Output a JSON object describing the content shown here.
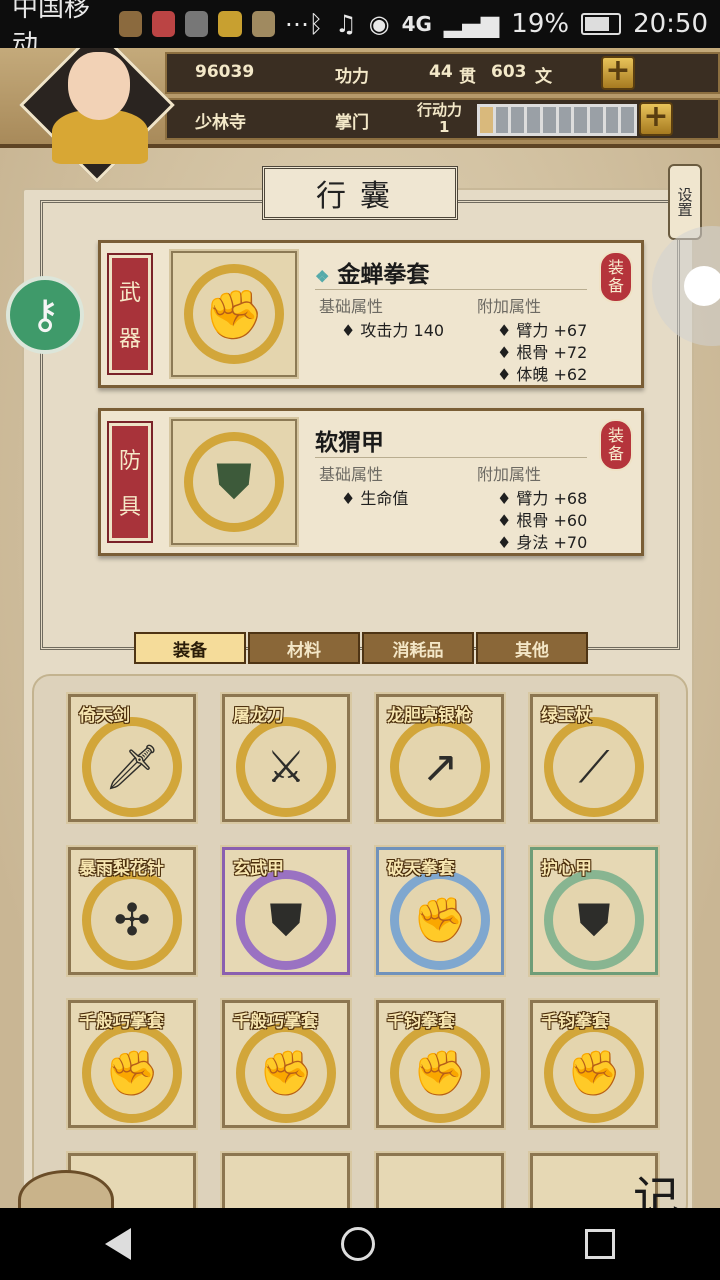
{
  "status_bar": {
    "carrier": "中国移动",
    "network": "4G",
    "battery_percent": "19%",
    "time": "20:50"
  },
  "header": {
    "power_value": "96039",
    "power_label": "功力",
    "money_guan": "44",
    "money_guan_unit": "贯",
    "money_wen": "603",
    "money_wen_unit": "文",
    "sect": "少林寺",
    "rank": "掌门",
    "stamina_label": "行动力",
    "stamina_value": "1",
    "stamina_segments_filled": 1,
    "stamina_segments_total": 10
  },
  "title": "行囊",
  "settings_label": "设置",
  "equipped": [
    {
      "slot_chars": [
        "武",
        "器"
      ],
      "name": "金蝉拳套",
      "base_header": "基础属性",
      "extra_header": "附加属性",
      "base_stats": [
        "♦ 攻击力 140"
      ],
      "extra_stats": [
        "♦ 臂力 +67",
        "♦ 根骨 +72",
        "♦ 体魄 +62"
      ],
      "equip_label": [
        "装",
        "备"
      ],
      "icon": "gauntlet-icon"
    },
    {
      "slot_chars": [
        "防",
        "具"
      ],
      "name": "软猬甲",
      "base_header": "基础属性",
      "extra_header": "附加属性",
      "base_stats": [
        "♦ 生命值"
      ],
      "extra_stats": [
        "♦ 臂力 +68",
        "♦ 根骨 +60",
        "♦ 身法 +70"
      ],
      "equip_label": [
        "装",
        "备"
      ],
      "icon": "armor-icon"
    }
  ],
  "tabs": [
    "装备",
    "材料",
    "消耗品",
    "其他"
  ],
  "active_tab": 0,
  "items": [
    {
      "name": "倚天剑",
      "rarity": "gold",
      "icon": "sword-icon"
    },
    {
      "name": "屠龙刀",
      "rarity": "gold",
      "icon": "saber-icon"
    },
    {
      "name": "龙胆亮银枪",
      "rarity": "gold",
      "icon": "spear-icon"
    },
    {
      "name": "绿玉杖",
      "rarity": "gold",
      "icon": "staff-icon"
    },
    {
      "name": "暴雨梨花针",
      "rarity": "gold",
      "icon": "needles-icon"
    },
    {
      "name": "玄武甲",
      "rarity": "purple",
      "icon": "armor-icon"
    },
    {
      "name": "破天拳套",
      "rarity": "blue",
      "icon": "gauntlet-icon"
    },
    {
      "name": "护心甲",
      "rarity": "green",
      "icon": "armor-icon"
    },
    {
      "name": "千般巧掌套",
      "rarity": "gold",
      "icon": "gauntlet-icon"
    },
    {
      "name": "千般巧掌套",
      "rarity": "gold",
      "icon": "gauntlet-icon"
    },
    {
      "name": "千钧拳套",
      "rarity": "gold",
      "icon": "gauntlet-icon"
    },
    {
      "name": "千钧拳套",
      "rarity": "gold",
      "icon": "gauntlet-icon"
    }
  ],
  "colors": {
    "gold": "#d2a63a",
    "purple": "#9a72c2",
    "blue": "#7fa7cf",
    "green": "#88b591",
    "slot_red": "#a8333a"
  },
  "corner_log_char": "记"
}
